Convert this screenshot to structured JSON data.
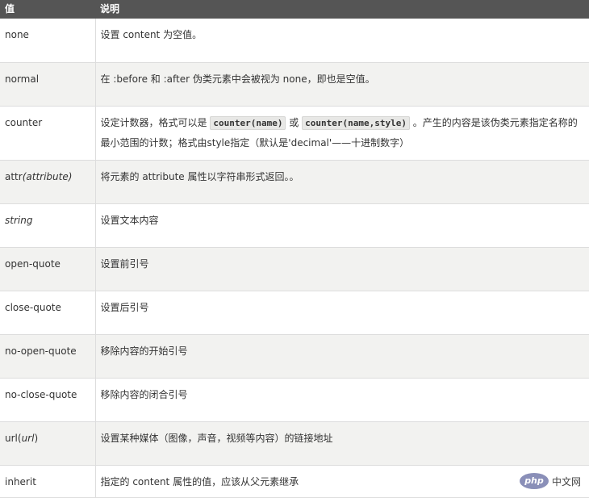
{
  "header": {
    "col_value": "值",
    "col_desc": "说明"
  },
  "rows": [
    {
      "value": "none",
      "desc": "设置 content 为空值。"
    },
    {
      "value": "normal",
      "desc": "在 :before 和 :after 伪类元素中会被视为 none，即也是空值。"
    },
    {
      "value": "counter",
      "desc_before": "设定计数器，格式可以是",
      "code1": "counter(name)",
      "desc_mid": "或",
      "code2": "counter(name,style)",
      "desc_after": "。产生的内容是该伪类元素指定名称的最小范围的计数；格式由style指定（默认是'decimal'——十进制数字）"
    },
    {
      "value_plain": "attr",
      "value_italic": "(attribute)",
      "desc": "将元素的 attribute 属性以字符串形式返回。。"
    },
    {
      "value_italic": "string",
      "desc": "设置文本内容"
    },
    {
      "value": "open-quote",
      "desc": "设置前引号"
    },
    {
      "value": "close-quote",
      "desc": "设置后引号"
    },
    {
      "value": "no-open-quote",
      "desc": "移除内容的开始引号"
    },
    {
      "value": "no-close-quote",
      "desc": "移除内容的闭合引号"
    },
    {
      "value_plain": "url(",
      "value_italic": "url",
      "value_close": ")",
      "desc": "设置某种媒体（图像，声音，视频等内容）的链接地址"
    },
    {
      "value": "inherit",
      "desc": "指定的 content 属性的值，应该从父元素继承"
    }
  ],
  "watermark": {
    "logo": "php",
    "text": "中文网"
  }
}
